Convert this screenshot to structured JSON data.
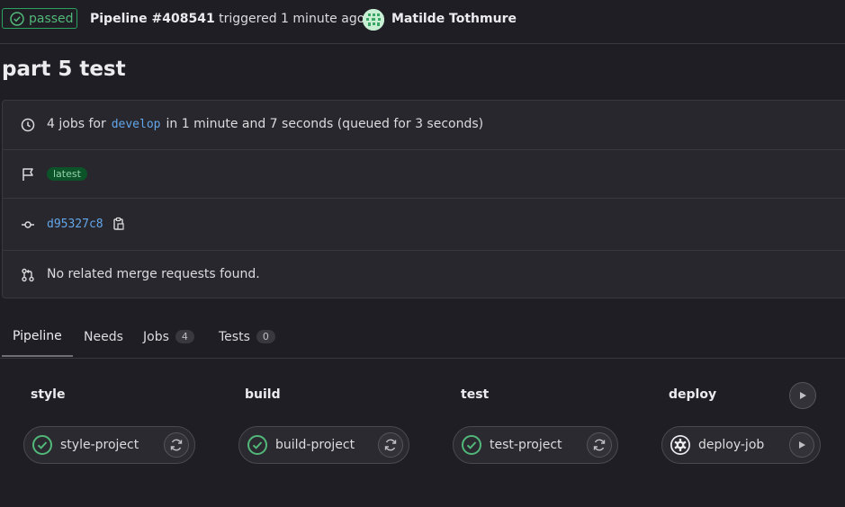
{
  "header": {
    "status_label": "passed",
    "pipeline_label": "Pipeline #408541",
    "trigger_text": "triggered 1 minute ago by",
    "author": "Matilde Tothmure"
  },
  "title": "part 5 test",
  "info": {
    "jobs_prefix": "4 jobs for",
    "branch": "develop",
    "jobs_suffix": "in 1 minute and 7 seconds (queued for 3 seconds)",
    "tag": "latest",
    "commit": "d95327c8",
    "merge_requests": "No related merge requests found."
  },
  "tabs": [
    {
      "label": "Pipeline",
      "count": null
    },
    {
      "label": "Needs",
      "count": null
    },
    {
      "label": "Jobs",
      "count": "4"
    },
    {
      "label": "Tests",
      "count": "0"
    }
  ],
  "stages": [
    {
      "name": "style",
      "job": "style-project",
      "status": "success",
      "action": "retry-icon"
    },
    {
      "name": "build",
      "job": "build-project",
      "status": "success",
      "action": "retry-icon"
    },
    {
      "name": "test",
      "job": "test-project",
      "status": "success",
      "action": "retry-icon"
    },
    {
      "name": "deploy",
      "job": "deploy-job",
      "status": "manual",
      "action": "play-icon"
    }
  ],
  "colors": {
    "success": "#52b87a",
    "link": "#63a6e9",
    "background": "#1f1e24"
  }
}
